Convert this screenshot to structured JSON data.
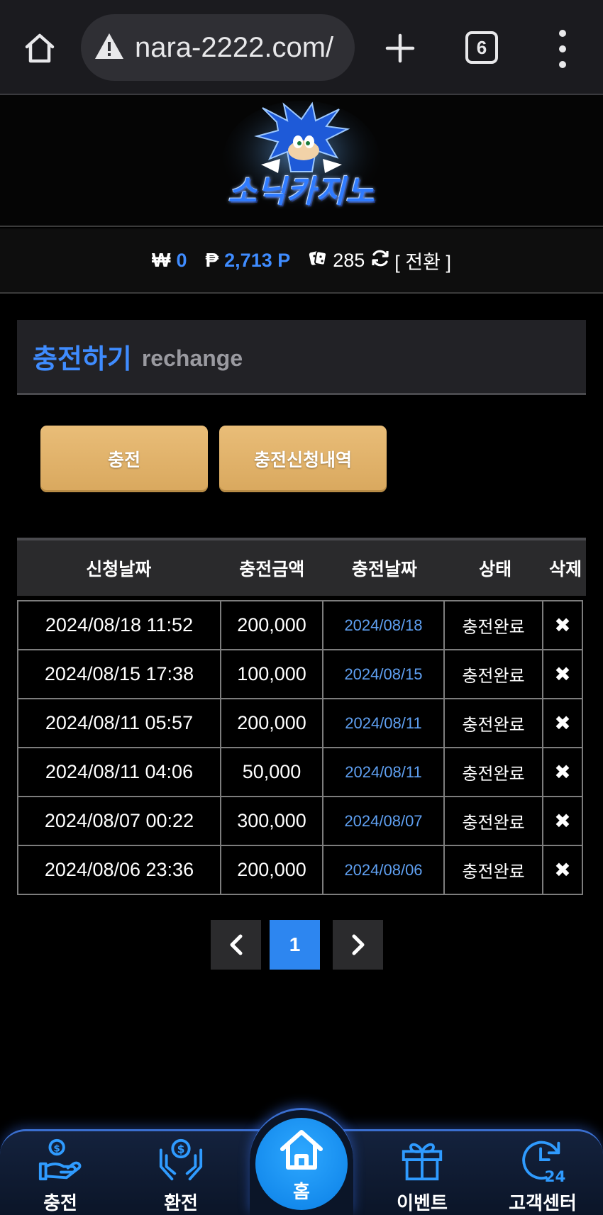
{
  "browser": {
    "url": "nara-2222.com/",
    "tab_count": "6"
  },
  "site": {
    "logo_text": "소닉카지노"
  },
  "balance": {
    "won_symbol": "₩",
    "won_value": "0",
    "point_symbol": "₱",
    "point_value": "2,713 P",
    "chip_value": "285",
    "convert_label": "[ 전환 ]"
  },
  "section": {
    "title_ko": "충전하기",
    "title_en": "rechange"
  },
  "actions": {
    "charge_label": "충전",
    "history_label": "충전신청내역"
  },
  "table": {
    "headers": [
      "신청날짜",
      "충전금액",
      "충전날짜",
      "상태",
      "삭제"
    ],
    "rows": [
      {
        "requested": "2024/08/18 11:52",
        "amount": "200,000",
        "charged": "2024/08/18",
        "status": "충전완료",
        "delete": "✖"
      },
      {
        "requested": "2024/08/15 17:38",
        "amount": "100,000",
        "charged": "2024/08/15",
        "status": "충전완료",
        "delete": "✖"
      },
      {
        "requested": "2024/08/11 05:57",
        "amount": "200,000",
        "charged": "2024/08/11",
        "status": "충전완료",
        "delete": "✖"
      },
      {
        "requested": "2024/08/11 04:06",
        "amount": "50,000",
        "charged": "2024/08/11",
        "status": "충전완료",
        "delete": "✖"
      },
      {
        "requested": "2024/08/07 00:22",
        "amount": "300,000",
        "charged": "2024/08/07",
        "status": "충전완료",
        "delete": "✖"
      },
      {
        "requested": "2024/08/06 23:36",
        "amount": "200,000",
        "charged": "2024/08/06",
        "status": "충전완료",
        "delete": "✖"
      }
    ]
  },
  "pagination": {
    "current_page": "1"
  },
  "bottom_nav": {
    "charge": "충전",
    "exchange": "환전",
    "home": "홈",
    "event": "이벤트",
    "support": "고객센터"
  },
  "colors": {
    "accent_blue": "#3f8cff",
    "button_gold": "#e2b26b",
    "page_bg": "#000000"
  }
}
